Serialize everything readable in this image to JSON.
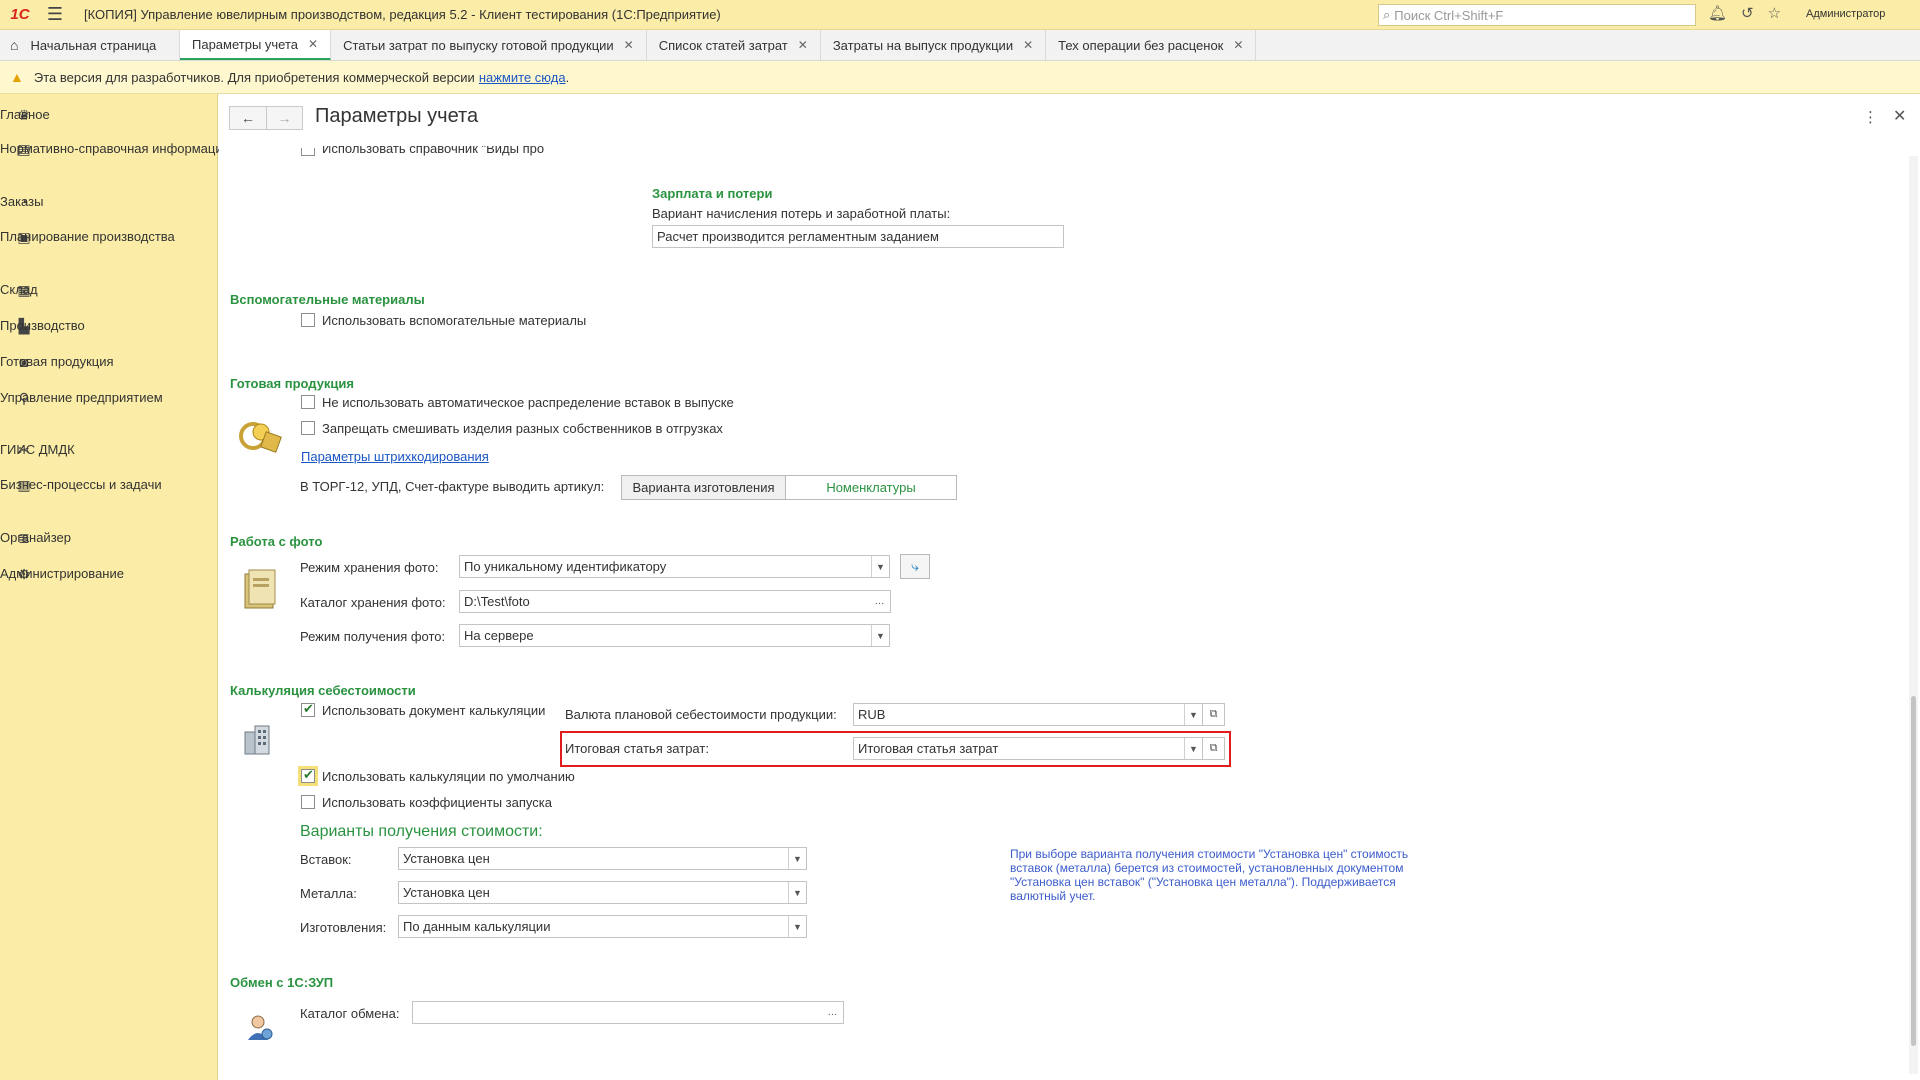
{
  "app": {
    "logo": "1С",
    "title": "[КОПИЯ] Управление ювелирным производством, редакция 5.2  - Клиент тестирования (1С:Предприятие)",
    "search_placeholder": "Поиск Ctrl+Shift+F",
    "user": "Администратор"
  },
  "tabs": [
    {
      "label": "Начальная страница"
    },
    {
      "label": "Параметры учета",
      "active": true
    },
    {
      "label": "Статьи затрат по выпуску готовой продукции"
    },
    {
      "label": "Список статей затрат"
    },
    {
      "label": "Затраты на выпуск продукции"
    },
    {
      "label": "Тех операции без расценок"
    }
  ],
  "notice": {
    "text": "Эта версия для разработчиков. Для приобретения коммерческой версии",
    "link": "нажмите сюда",
    "end": "."
  },
  "sidebar": {
    "items": [
      {
        "label": "Главное",
        "icon": "crown-icon"
      },
      {
        "label": "Нормативно-справочная информация",
        "icon": "book-icon"
      },
      {
        "label": "Заказы",
        "icon": "pie-icon"
      },
      {
        "label": "Планирование производства",
        "icon": "clipboard-icon"
      },
      {
        "label": "Склад",
        "icon": "grid-icon"
      },
      {
        "label": "Производство",
        "icon": "factory-icon"
      },
      {
        "label": "Готовая продукция",
        "icon": "bag-icon"
      },
      {
        "label": "Управление предприятием",
        "icon": "org-icon"
      },
      {
        "label": "ГИИС ДМДК",
        "icon": "tools-icon"
      },
      {
        "label": "Бизнес-процессы и задачи",
        "icon": "document-icon"
      },
      {
        "label": "Органайзер",
        "icon": "list-icon"
      },
      {
        "label": "Администрирование",
        "icon": "gear-icon"
      }
    ]
  },
  "page": {
    "title": "Параметры учета",
    "truncated_top": "Использовать справочник \"Виды про",
    "salary": {
      "heading": "Зарплата и потери",
      "label": "Вариант начисления потерь и заработной платы:",
      "value": "Расчет производится регламентным заданием"
    },
    "aux": {
      "heading": "Вспомогательные материалы",
      "cb": "Использовать вспомогательные материалы"
    },
    "finished": {
      "heading": "Готовая продукция",
      "cb1": "Не использовать автоматическое распределение вставок в выпуске",
      "cb2": "Запрещать смешивать изделия разных собственников в отгрузках",
      "link": "Параметры штрихкодирования",
      "article_label": "В ТОРГ-12, УПД, Счет-фактуре выводить артикул:",
      "opt1": "Варианта изготовления",
      "opt2": "Номенклатуры"
    },
    "photo": {
      "heading": "Работа с фото",
      "mode_label": "Режим хранения фото:",
      "mode_value": "По уникальному идентификатору",
      "dir_label": "Каталог хранения фото:",
      "dir_value": "D:\\Test\\foto",
      "get_label": "Режим получения фото:",
      "get_value": "На сервере"
    },
    "calc": {
      "heading": "Калькуляция себестоимости",
      "cb_doc": "Использовать документ калькуляции",
      "currency_label": "Валюта плановой себестоимости продукции:",
      "currency_value": "RUB",
      "total_label": "Итоговая статья затрат:",
      "total_value": "Итоговая статья затрат",
      "cb_default": "Использовать калькуляции по умолчанию",
      "cb_coef": "Использовать коэффициенты запуска",
      "variants_heading": "Варианты получения стоимости:",
      "inserts_label": "Вставок:",
      "inserts_value": "Установка цен",
      "metal_label": "Металла:",
      "metal_value": "Установка цен",
      "make_label": "Изготовления:",
      "make_value": "По данным калькуляции",
      "hint": "При выборе варианта получения стоимости \"Установка цен\" стоимость вставок (металла) берется из стоимостей, установленных документом \"Установка цен вставок\" (\"Установка цен металла\"). Поддерживается валютный учет."
    },
    "zup": {
      "heading": "Обмен с 1С:ЗУП",
      "dir_label": "Каталог обмена:",
      "dir_value": ""
    }
  },
  "colors": {
    "accent_green": "#2a9340",
    "sidebar_bg": "#fbeda7",
    "highlight_red": "#e01c1c",
    "link_blue": "#1a56c4"
  }
}
